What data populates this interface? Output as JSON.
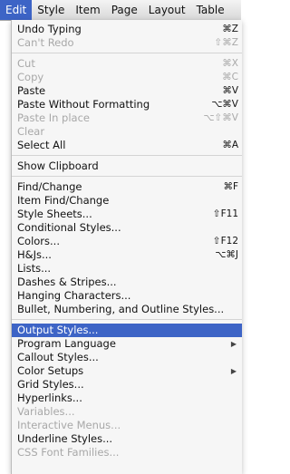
{
  "menubar": {
    "items": [
      "Edit",
      "Style",
      "Item",
      "Page",
      "Layout",
      "Table"
    ]
  },
  "menu": {
    "group1": [
      {
        "label": "Undo Typing",
        "shortcut": "⌘Z",
        "enabled": true
      },
      {
        "label": "Can't Redo",
        "shortcut": "⇧⌘Z",
        "enabled": false
      }
    ],
    "group2": [
      {
        "label": "Cut",
        "shortcut": "⌘X",
        "enabled": false
      },
      {
        "label": "Copy",
        "shortcut": "⌘C",
        "enabled": false
      },
      {
        "label": "Paste",
        "shortcut": "⌘V",
        "enabled": true
      },
      {
        "label": "Paste Without Formatting",
        "shortcut": "⌥⌘V",
        "enabled": true
      },
      {
        "label": "Paste In place",
        "shortcut": "⌥⇧⌘V",
        "enabled": false
      },
      {
        "label": "Clear",
        "shortcut": "",
        "enabled": false
      },
      {
        "label": "Select All",
        "shortcut": "⌘A",
        "enabled": true
      }
    ],
    "group3": [
      {
        "label": "Show Clipboard",
        "shortcut": "",
        "enabled": true
      }
    ],
    "group4": [
      {
        "label": "Find/Change",
        "shortcut": "⌘F",
        "enabled": true
      },
      {
        "label": "Item Find/Change",
        "shortcut": "",
        "enabled": true
      },
      {
        "label": "Style Sheets...",
        "shortcut": "⇧F11",
        "enabled": true
      },
      {
        "label": "Conditional Styles...",
        "shortcut": "",
        "enabled": true
      },
      {
        "label": "Colors...",
        "shortcut": "⇧F12",
        "enabled": true
      },
      {
        "label": "H&Js...",
        "shortcut": "⌥⌘J",
        "enabled": true
      },
      {
        "label": "Lists...",
        "shortcut": "",
        "enabled": true
      },
      {
        "label": "Dashes & Stripes...",
        "shortcut": "",
        "enabled": true
      },
      {
        "label": "Hanging Characters...",
        "shortcut": "",
        "enabled": true
      },
      {
        "label": "Bullet, Numbering, and Outline Styles...",
        "shortcut": "",
        "enabled": true
      }
    ],
    "group5": [
      {
        "label": "Output Styles...",
        "enabled": true,
        "highlighted": true,
        "submenu": false
      },
      {
        "label": "Program Language",
        "enabled": true,
        "submenu": true
      },
      {
        "label": "Callout Styles...",
        "enabled": true,
        "submenu": false
      },
      {
        "label": "Color Setups",
        "enabled": true,
        "submenu": true
      },
      {
        "label": "Grid Styles...",
        "enabled": true,
        "submenu": false
      },
      {
        "label": "Hyperlinks...",
        "enabled": true,
        "submenu": false
      },
      {
        "label": "Variables...",
        "enabled": false,
        "submenu": false
      },
      {
        "label": "Interactive Menus...",
        "enabled": false,
        "submenu": false
      },
      {
        "label": "Underline Styles...",
        "enabled": true,
        "submenu": false
      },
      {
        "label": "CSS Font Families...",
        "enabled": false,
        "submenu": false
      }
    ],
    "submenu_arrow": "▶"
  },
  "colors": {
    "highlight": "#3d64c6",
    "disabled_text": "#a8a8a8"
  }
}
